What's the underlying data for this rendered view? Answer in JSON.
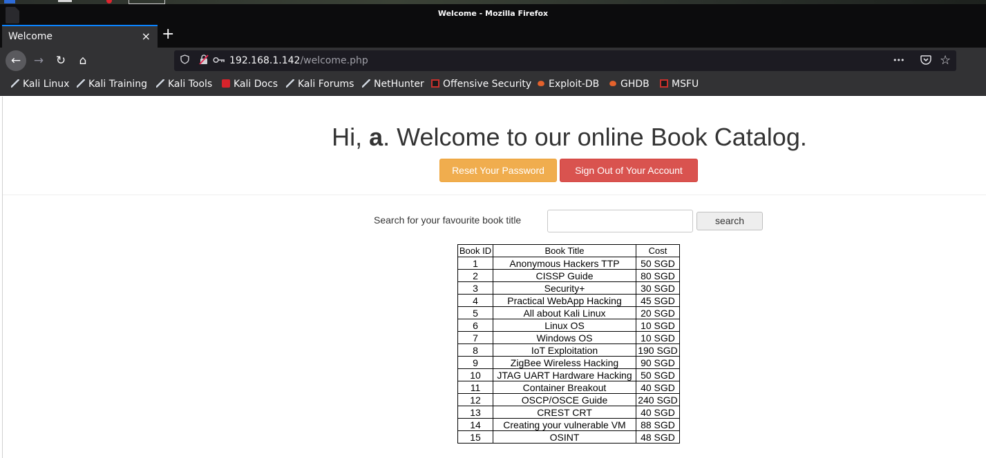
{
  "window": {
    "title": "Welcome - Mozilla Firefox"
  },
  "tab": {
    "label": "Welcome",
    "close": "×",
    "new_tab": "+"
  },
  "navbar": {
    "back": "←",
    "forward": "→",
    "reload": "↻",
    "home": "⌂",
    "url_host": "192.168.1.142",
    "url_path": "/welcome.php",
    "page_actions": "•••"
  },
  "bookmarks": [
    {
      "label": "Kali Linux",
      "icon": "kali-dragon-icon"
    },
    {
      "label": "Kali Training",
      "icon": "kali-dragon-icon"
    },
    {
      "label": "Kali Tools",
      "icon": "kali-dragon-icon"
    },
    {
      "label": "Kali Docs",
      "icon": "kali-docs-icon"
    },
    {
      "label": "Kali Forums",
      "icon": "kali-dragon-icon"
    },
    {
      "label": "NetHunter",
      "icon": "kali-dragon-icon"
    },
    {
      "label": "Offensive Security",
      "icon": "offsec-icon"
    },
    {
      "label": "Exploit-DB",
      "icon": "exploitdb-icon"
    },
    {
      "label": "GHDB",
      "icon": "exploitdb-icon"
    },
    {
      "label": "MSFU",
      "icon": "offsec-icon"
    }
  ],
  "page": {
    "greeting_prefix": "Hi, ",
    "username": "a",
    "greeting_suffix": ". Welcome to our online Book Catalog.",
    "reset_button": "Reset Your Password",
    "signout_button": "Sign Out of Your Account",
    "search_label": "Search for your favourite book title",
    "search_value": "",
    "search_button": "search",
    "colors": {
      "reset": "#f0ad4e",
      "signout": "#d9534f"
    }
  },
  "table": {
    "headers": [
      "Book ID",
      "Book Title",
      "Cost"
    ],
    "rows": [
      [
        "1",
        "Anonymous Hackers TTP",
        "50 SGD"
      ],
      [
        "2",
        "CISSP Guide",
        "80 SGD"
      ],
      [
        "3",
        "Security+",
        "30 SGD"
      ],
      [
        "4",
        "Practical WebApp Hacking",
        "45 SGD"
      ],
      [
        "5",
        "All about Kali Linux",
        "20 SGD"
      ],
      [
        "6",
        "Linux OS",
        "10 SGD"
      ],
      [
        "7",
        "Windows OS",
        "10 SGD"
      ],
      [
        "8",
        "IoT Exploitation",
        "190 SGD"
      ],
      [
        "9",
        "ZigBee Wireless Hacking",
        "90 SGD"
      ],
      [
        "10",
        "JTAG UART Hardware Hacking",
        "50 SGD"
      ],
      [
        "11",
        "Container Breakout",
        "40 SGD"
      ],
      [
        "12",
        "OSCP/OSCE Guide",
        "240 SGD"
      ],
      [
        "13",
        "CREST CRT",
        "40 SGD"
      ],
      [
        "14",
        "Creating your vulnerable VM",
        "88 SGD"
      ],
      [
        "15",
        "OSINT",
        "48 SGD"
      ]
    ]
  }
}
